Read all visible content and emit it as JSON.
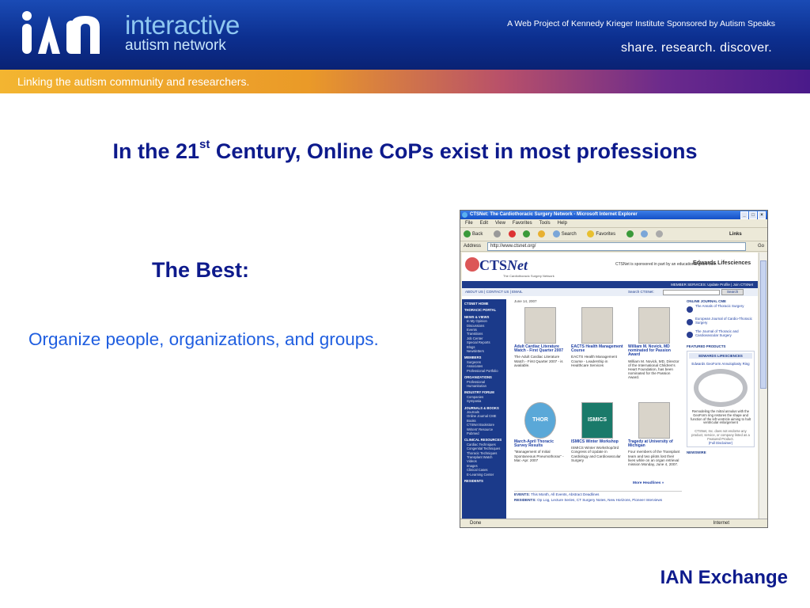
{
  "header": {
    "logo_letters": "IAN",
    "logo_line1": "interactive",
    "logo_line2": "autism network",
    "project_line": "A Web Project of Kennedy Krieger Institute  Sponsored by Autism Speaks",
    "tagline": "share. research. discover.",
    "band_text": "Linking the autism community and researchers."
  },
  "slide": {
    "title_pre": "In the 21",
    "title_sup": "st",
    "title_post": "  Century, Online CoPs exist in most professions",
    "best_heading": "The Best:",
    "body": "Organize people, organizations, and groups.",
    "footer": "IAN Exchange"
  },
  "browser": {
    "window_title": "CTSNet: The Cardiothoracic Surgery Network - Microsoft Internet Explorer",
    "menu": [
      "File",
      "Edit",
      "View",
      "Favorites",
      "Tools",
      "Help"
    ],
    "toolbar": [
      "Back",
      "Search",
      "Favorites"
    ],
    "links_label": "Links",
    "address_label": "Address",
    "address_value": "http://www.ctsnet.org/",
    "go_label": "Go",
    "status_left": "Done",
    "status_right": "Internet",
    "site": {
      "logo": "CTS",
      "logo_italic": "Net",
      "logo_sub": "The Cardiothoracic Surgery Network",
      "sponsor": "CTSNet is sponsored in part by an educational grant from",
      "sponsor_name": "Edwards Lifesciences",
      "nav_left": "ABOUT US | CONTACT US | EMAIL",
      "nav_right": "MEMBER SERVICES: Update Profile | Join CTSNet",
      "search_label": "Search CTSNet:",
      "search_button": "Search",
      "date": "June 14, 2007",
      "left_nav": [
        {
          "t": "CTSNET HOME",
          "h": true
        },
        {
          "t": "THORACIC PORTAL",
          "h": true
        },
        {
          "t": "NEWS & VIEWS",
          "h": true
        },
        {
          "t": "In My Opinion"
        },
        {
          "t": "Discussions"
        },
        {
          "t": "Events"
        },
        {
          "t": "Transitions"
        },
        {
          "t": "Job Center"
        },
        {
          "t": "Special Reports"
        },
        {
          "t": "Blogs"
        },
        {
          "t": "Newsletters"
        },
        {
          "t": "MEMBERS",
          "h": true
        },
        {
          "t": "Surgeons"
        },
        {
          "t": "Associates"
        },
        {
          "t": "Professional Portfolio"
        },
        {
          "t": "ORGANIZATIONS",
          "h": true
        },
        {
          "t": "Professional"
        },
        {
          "t": "Humanitarian"
        },
        {
          "t": "INDUSTRY FORUM",
          "h": true
        },
        {
          "t": "Companies"
        },
        {
          "t": "Symposia"
        },
        {
          "t": "JOURNALS & BOOKS",
          "h": true
        },
        {
          "t": "Journals"
        },
        {
          "t": "Online Journal CME"
        },
        {
          "t": "Books"
        },
        {
          "t": "CTSNet Bookstore"
        },
        {
          "t": "Writers' Resource"
        },
        {
          "t": "Pubmed"
        },
        {
          "t": "CLINICAL RESOURCES",
          "h": true
        },
        {
          "t": "Cardiac Techniques"
        },
        {
          "t": "Congenital Techniques"
        },
        {
          "t": "Thoracic Techniques"
        },
        {
          "t": "Transplant Watch"
        },
        {
          "t": "Videos"
        },
        {
          "t": "Images"
        },
        {
          "t": "Clinical Cases"
        },
        {
          "t": "E-Learning Center"
        },
        {
          "t": "RESIDENTS",
          "h": true
        }
      ],
      "articles": [
        {
          "title": "Adult Cardiac Literature Watch - First Quarter 2007",
          "text": "The Adult Cardiac Literature Watch - First Quarter 2007 - is available."
        },
        {
          "title": "EACTS Health Management Course",
          "text": "EACTS Health Management Course - Leadership in Healthcare Services"
        },
        {
          "title": "William M. Novick, MD nominated for Passion Award",
          "text": "William M. Novick, MD, Director of the International Children's Heart Foundation, has been nominated for the Passion Award."
        },
        {
          "title": "March-April Thoracic Survey Results",
          "text": "\"Management of Initial Spontaneous Pneumothorax\" - Mar.-Apr. 2007",
          "badge": "THOR"
        },
        {
          "title": "ISMICS Winter Workshop",
          "text": "ISMICS Winter Workshop/3rd Congress of Update in Cardiology and Cardiovascular Surgery",
          "badge": "ISMICS"
        },
        {
          "title": "Tragedy at University of Michigan",
          "text": "Four members of the Transplant team and two pilots lost their lives while on an organ retrieval mission Monday, June 4, 2007."
        }
      ],
      "more_headlines": "More Headlines »",
      "events_label": "EVENTS:",
      "events_text": "This Month, All Events, Abstract Deadlines",
      "residents_label": "RESIDENTS:",
      "residents_text": "Op Log, Lecture Series, CT Surgery Notes, New Horizons, Pioneer Interviews",
      "online_cme": "ONLINE JOURNAL CME",
      "journals": [
        "The Annals of Thoracic Surgery",
        "European Journal of Cardio-Thoracic Surgery",
        "The Journal of Thoracic and Cardiovascular Surgery"
      ],
      "featured": "FEATURED PRODUCTS",
      "featured_bar": "EDWARDS LIFESCIENCES",
      "featured_link": "Edwards GeoForm Annuloplasty Ring",
      "featured_desc": "Remodeling the mitral annulus with the GeoForm ring restores the shape and function of the left ventricle aiming to halt ventricular enlargement",
      "disclaimer": "CTSNet, Inc. does not endorse any product, service, or company listed as a Featured Product.",
      "disclaimer_link": "(Full Disclaimer)",
      "newswire": "NEWSWIRE"
    }
  }
}
